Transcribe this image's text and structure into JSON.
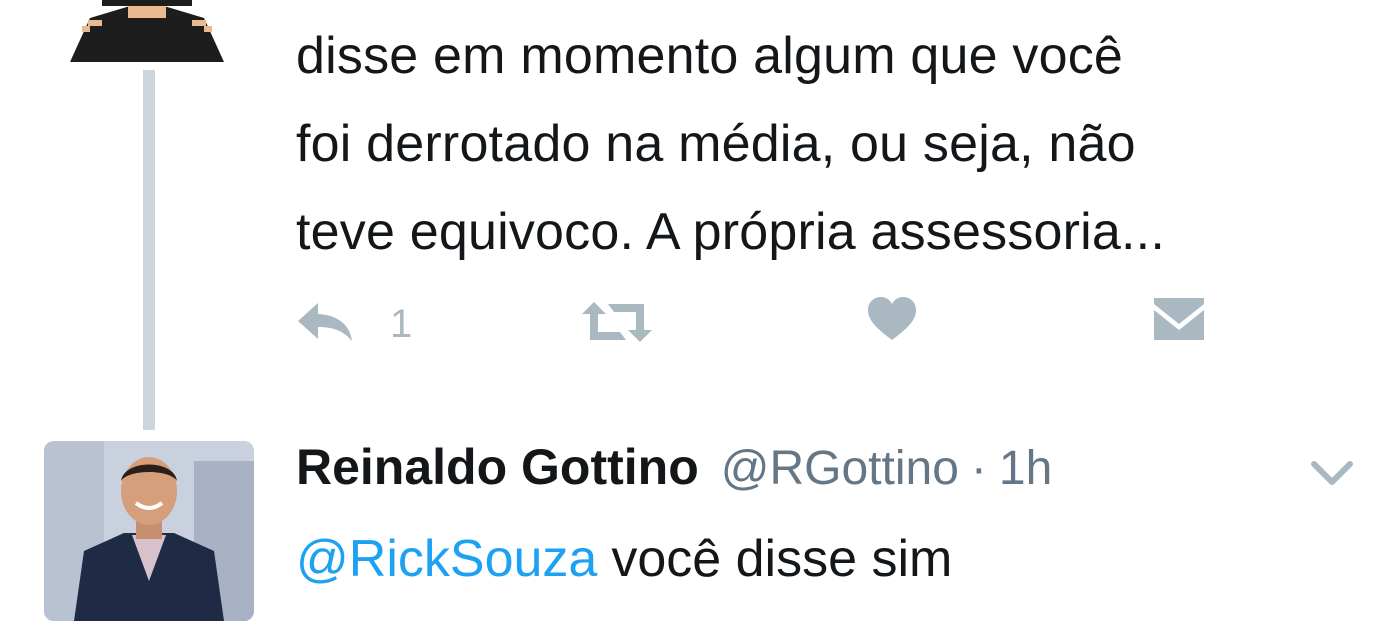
{
  "thread": {
    "first_tweet": {
      "text_lines": [
        "disse em momento algum que você",
        "foi derrotado na média, ou seja, não",
        "teve equivoco. A própria assessoria..."
      ],
      "avatar_icon": "pixel-avatar-icon"
    },
    "actions": {
      "reply_count": "1",
      "icons": [
        "reply-icon",
        "retweet-icon",
        "like-icon",
        "direct-message-icon"
      ],
      "color": "#aab8c2"
    },
    "second_tweet": {
      "display_name": "Reinaldo Gottino",
      "handle": "@RGottino",
      "separator": "·",
      "time": "1h",
      "mention": "@RickSouza",
      "text": "você disse sim",
      "menu_icon": "chevron-down-icon",
      "avatar_icon": "profile-photo"
    }
  },
  "colors": {
    "text": "#14171a",
    "secondary": "#657786",
    "link": "#1da1f2",
    "thread_line": "#ccd6dd"
  }
}
